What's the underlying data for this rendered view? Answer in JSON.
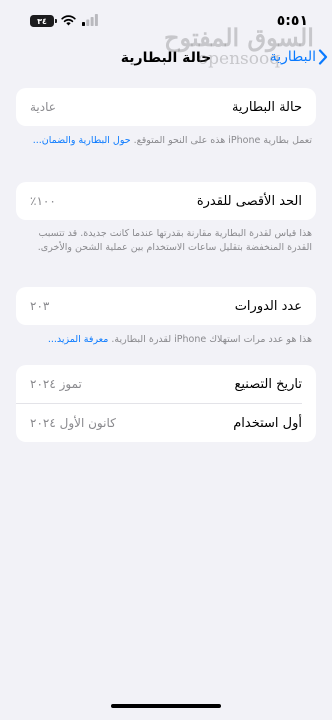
{
  "status_bar": {
    "time": "٥:٥١",
    "battery_level": "٣٤",
    "icons": [
      "battery-icon",
      "wifi-icon",
      "signal-icon"
    ]
  },
  "nav": {
    "title": "حالة البطارية",
    "back_label": "البطارية"
  },
  "watermark": {
    "arabic": "السوق المفتوح",
    "latin": "opensooq"
  },
  "battery_health": {
    "label": "حالة البطارية",
    "value": "عادية",
    "note": "تعمل بطارية iPhone هذه على النحو المتوقع.",
    "link": "حول البطارية والضمان..."
  },
  "max_capacity": {
    "label": "الحد الأقصى للقدرة",
    "value": "١٠٠٪",
    "note": "هذا قياس لقدرة البطارية مقارنة بقدرتها عندما كانت جديدة. قد تتسبب القدرة المنخفضة بتقليل ساعات الاستخدام بين عملية الشحن والأخرى."
  },
  "cycle_count": {
    "label": "عدد الدورات",
    "value": "٢٠٣",
    "note": "هذا هو عدد مرات استهلاك iPhone لقدرة البطارية.",
    "link": "معرفة المزيد..."
  },
  "dates": {
    "manufacture_label": "تاريخ التصنيع",
    "manufacture_value": "تموز ٢٠٢٤",
    "first_use_label": "أول استخدام",
    "first_use_value": "كانون الأول ٢٠٢٤"
  },
  "colors": {
    "background": "#f2f2f7",
    "accent": "#0a7aff",
    "secondary_text": "#8a8a8e"
  }
}
